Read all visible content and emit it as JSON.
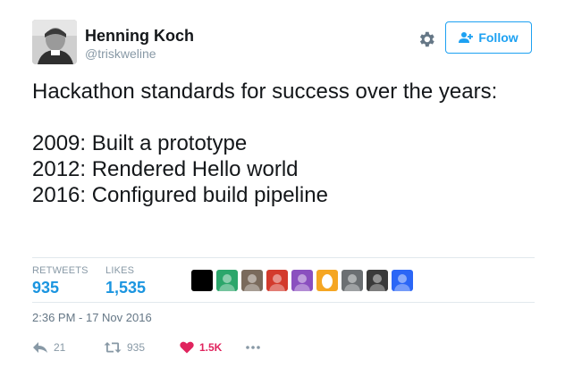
{
  "colors": {
    "accent": "#1da1f2",
    "stat_value": "#1b95e0",
    "muted": "#8899a6",
    "like": "#e0245e",
    "divider": "#e1e8ed"
  },
  "user": {
    "name": "Henning Koch",
    "handle": "@triskweline",
    "avatar_icon": "profile-photo"
  },
  "header": {
    "gear_icon": "gear-icon",
    "follow_label": "Follow",
    "follow_icon": "add-user-icon"
  },
  "tweet": {
    "text": "Hackathon standards for success over the years:\n\n2009: Built a prototype\n2012: Rendered Hello world\n2016: Configured build pipeline"
  },
  "stats": {
    "retweets_label": "RETWEETS",
    "retweets_value": "935",
    "likes_label": "LIKES",
    "likes_value": "1,535",
    "likers": [
      {
        "icon": "liker-avatar-black",
        "color": "#000000"
      },
      {
        "icon": "liker-avatar-green-blue",
        "color": "#2ca66b"
      },
      {
        "icon": "liker-avatar-photo",
        "color": "#7a6a5c"
      },
      {
        "icon": "liker-avatar-pixel",
        "color": "#d33a2c"
      },
      {
        "icon": "liker-avatar-purple",
        "color": "#8a4fbf"
      },
      {
        "icon": "liker-avatar-egg",
        "color": "#f5a623"
      },
      {
        "icon": "liker-avatar-photo-2",
        "color": "#6b6f72"
      },
      {
        "icon": "liker-avatar-dark",
        "color": "#3a3a3a"
      },
      {
        "icon": "liker-avatar-blue-badge",
        "color": "#2b66f6"
      }
    ]
  },
  "timestamp": "2:36 PM - 17 Nov 2016",
  "actions": {
    "reply_count": "21",
    "retweet_count": "935",
    "like_count": "1.5K",
    "reply_icon": "reply-icon",
    "retweet_icon": "retweet-icon",
    "like_icon": "heart-icon",
    "more_icon": "more-icon"
  }
}
